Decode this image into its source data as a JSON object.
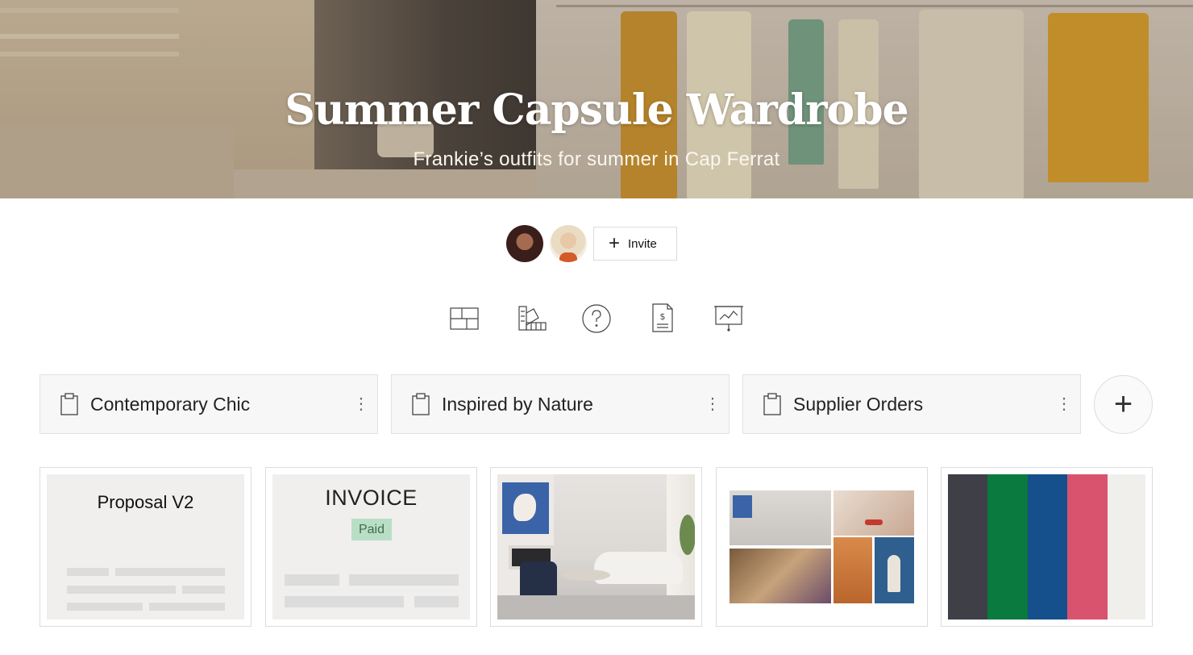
{
  "hero": {
    "title": "Summer Capsule Wardrobe",
    "subtitle": "Frankie’s outfits for summer in Cap Ferrat"
  },
  "collaborators": {
    "avatars": [
      "avatar-1",
      "avatar-2"
    ],
    "invite_label": "Invite"
  },
  "tools": [
    {
      "icon": "layout-grid-icon"
    },
    {
      "icon": "color-swatch-ruler-icon"
    },
    {
      "icon": "question-circle-icon"
    },
    {
      "icon": "invoice-dollar-icon"
    },
    {
      "icon": "presentation-chart-icon"
    }
  ],
  "folders": [
    {
      "name": "Contemporary Chic"
    },
    {
      "name": "Inspired by Nature"
    },
    {
      "name": "Supplier Orders"
    }
  ],
  "cards": {
    "proposal_title": "Proposal V2",
    "invoice_title": "INVOICE",
    "invoice_status": "Paid",
    "palette": [
      "#3f3f48",
      "#0a7a3e",
      "#154f8c",
      "#d9536f",
      "#f0efec"
    ]
  },
  "colors": {
    "accent_border": "#dcdcdc",
    "paid_badge": "#b8dfc5"
  }
}
